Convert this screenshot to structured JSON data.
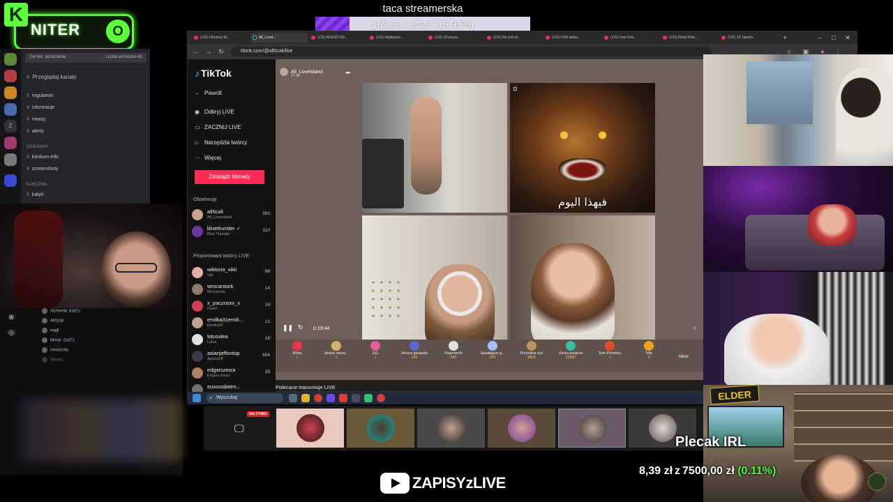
{
  "overlay": {
    "goal_title": "taca streamerska",
    "goal_text": "162.50 / 1020 (15.93%)",
    "goal_progress": 0.1593,
    "niter_text": "NITER",
    "niter_k": "K",
    "niter_o": "O",
    "plecak_title": "Plecak IRL",
    "plecak_current": "8,39 zł",
    "plecak_z": "z",
    "plecak_target": "7500,00 zł",
    "plecak_pct": "(0.11%)",
    "elder_logo": "ELDER",
    "zapisy_text": "ZAPISYzLIVE",
    "colors": {
      "goal_fill": "#7a34e0",
      "niter_green": "#5dff3c",
      "tiktok_pink": "#fe2c55",
      "pct_green": "#4dff3c"
    }
  },
  "discord": {
    "banner_left": "Cel dot. wzroczenia",
    "banner_right": "Liczba wzroczeń 42",
    "browse": "Przeglądaj kanały",
    "channels": [
      {
        "label": "regulamin",
        "icon": "rules-icon"
      },
      {
        "label": "informacje",
        "icon": "info-icon"
      },
      {
        "label": "newsy",
        "icon": "news-icon"
      },
      {
        "label": "alerty",
        "icon": "alert-icon"
      }
    ],
    "cat_giveaway": "GIVEAWAY",
    "giveaway_channels": [
      "konkurs-info",
      "screenshoty"
    ],
    "cat_karczma": "KARCZMA",
    "karczma_channels": [
      "katyń"
    ]
  },
  "browser": {
    "tabs": [
      "(131) Obrońcy W...",
      "All_Lovel...",
      "(131) AGENT ICE...",
      "(131) Najlepsze...",
      "(131) 10 przyw...",
      "(131) Na tych pr...",
      "(131) USA ataku...",
      "(131) Ivan Zoin...",
      "(131) Kiedy Polic...",
      "(131) 10 Tajemn..."
    ],
    "active_tab": 1,
    "new_tab": "+",
    "url": "tiktok.com/@all5cali/live",
    "win_min": "–",
    "win_max": "□",
    "win_close": "✕"
  },
  "tiktok": {
    "logo": "TikTok",
    "nav": [
      {
        "label": "Powrót",
        "icon": "arrow-left-icon"
      },
      {
        "label": "Odkryj LIVE",
        "icon": "live-icon"
      },
      {
        "label": "ZACZNIJ LIVE",
        "icon": "camera-icon"
      },
      {
        "label": "Narzędzia twórcy",
        "icon": "tools-icon"
      },
      {
        "label": "Więcej",
        "icon": "more-icon"
      }
    ],
    "monety_btn": "Zdobądź Monety",
    "following_title": "Obserwuję",
    "following": [
      {
        "name": "all5cali",
        "sub": "All_Loveisland",
        "count": "393"
      },
      {
        "name": "bluethunder",
        "sub": "Blue Thunder",
        "count": "110"
      }
    ],
    "suggested_title": "Proponowani twórcy LIVE",
    "suggested": [
      {
        "name": "wiktoria_vikii",
        "sub": "Viki",
        "count": "96"
      },
      {
        "name": "wrocaniock",
        "sub": "Wrocaniok",
        "count": "14"
      },
      {
        "name": "x_paczosxv_x",
        "sub": "Paveł",
        "count": "16"
      },
      {
        "name": "emilka31emili...",
        "sub": "Emilka30",
        "count": "13"
      },
      {
        "name": "lotusxlea",
        "sub": "Lotus",
        "count": "16"
      },
      {
        "name": "asianjeffontop",
        "sub": "AsianJeff",
        "count": "654"
      },
      {
        "name": "edgarszeiza",
        "sub": "Edgars Zeiza",
        "count": "39"
      },
      {
        "name": "eusouobatm...",
        "sub": "",
        "count": ""
      }
    ],
    "live_host": "All_Loveisland",
    "live_host_sub": "27.5K",
    "arabic_caption": "فيهذا اليوم",
    "time": "0:19:44",
    "gifts": [
      {
        "name": "Róża",
        "price": "1"
      },
      {
        "name": "Jesteś niesa...",
        "price": "1"
      },
      {
        "name": "GG",
        "price": "1"
      },
      {
        "name": "Nocna gwiazda",
        "price": "199"
      },
      {
        "name": "Fajerwerki",
        "price": "500"
      },
      {
        "name": "Spadające g...",
        "price": "500"
      },
      {
        "name": "Przytulna noc",
        "price": "4999"
      },
      {
        "name": "Zorza polarna",
        "price": "12000"
      },
      {
        "name": "Tom Pomidor",
        "price": "1"
      },
      {
        "name": "Tofu",
        "price": "5"
      }
    ],
    "more": "More",
    "polecane": "Polecane transmisje LIVE"
  },
  "taskbar": {
    "search": "Wyszukaj"
  },
  "thumbs": {
    "live_badge": "NA ŻYWO"
  },
  "chat": {
    "rows": [
      {
        "name": "Alchemik",
        "tag": "EMT2"
      },
      {
        "name": "AllScali",
        "tag": ""
      },
      {
        "name": "majll",
        "tag": ""
      },
      {
        "name": "Misior",
        "tag": "EMT2"
      },
      {
        "name": "newstrola",
        "tag": ""
      },
      {
        "name": "Wesko",
        "tag": ""
      }
    ]
  }
}
